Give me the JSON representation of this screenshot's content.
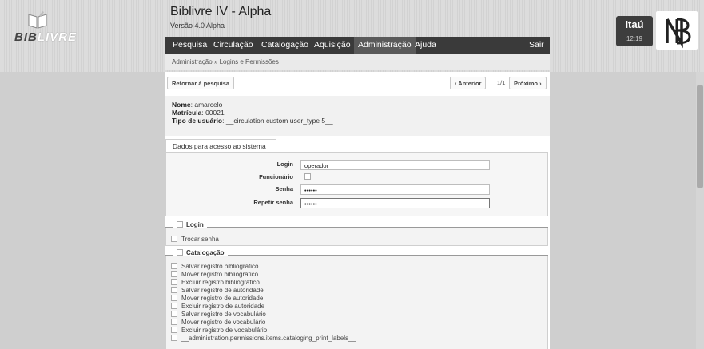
{
  "app": {
    "title": "Biblivre IV - Alpha",
    "version": "Versão 4.0 Alpha",
    "logo_text_dark": "BIB",
    "logo_text_light": "LIVRE"
  },
  "menu": {
    "items": [
      "Pesquisa",
      "Circulação",
      "Catalogação",
      "Aquisição",
      "Administração",
      "Ajuda"
    ],
    "logout": "Sair",
    "active": "Administração"
  },
  "breadcrumb": "Administração » Logins e Permissões",
  "institution": {
    "name": "Itaú",
    "time": "12:19"
  },
  "toolbar": {
    "back": "Retornar à pesquisa",
    "prev": "‹ Anterior",
    "page": "1/1",
    "next": "Próximo ›"
  },
  "user": {
    "name_label": "Nome",
    "name": "amarcelo",
    "matricula_label": "Matrícula",
    "matricula": "00021",
    "type_label": "Tipo de usuário",
    "type": "__circulation custom user_type 5__"
  },
  "access": {
    "tab": "Dados para acesso ao sistema",
    "login_label": "Login",
    "login_value": "operador",
    "employee_label": "Funcionário",
    "password_label": "Senha",
    "password_value": "••••••",
    "repeat_label": "Repetir senha",
    "repeat_value": "••••••"
  },
  "groups": {
    "login": {
      "title": "Login",
      "items": [
        "Trocar senha"
      ]
    },
    "cataloging": {
      "title": "Catalogação",
      "items": [
        "Salvar registro bibliográfico",
        "Mover registro bibliográfico",
        "Excluir registro bibliográfico",
        "Salvar registro de autoridade",
        "Mover registro de autoridade",
        "Excluir registro de autoridade",
        "Salvar registro de vocabulário",
        "Mover registro de vocabulário",
        "Excluir registro de vocabulário",
        "__administration.permissions.items.cataloging_print_labels__"
      ]
    }
  },
  "colors": {
    "menubar": "#3a3a3a",
    "panel": "#f6f6f6",
    "header_bg": "#d8d8d8"
  }
}
